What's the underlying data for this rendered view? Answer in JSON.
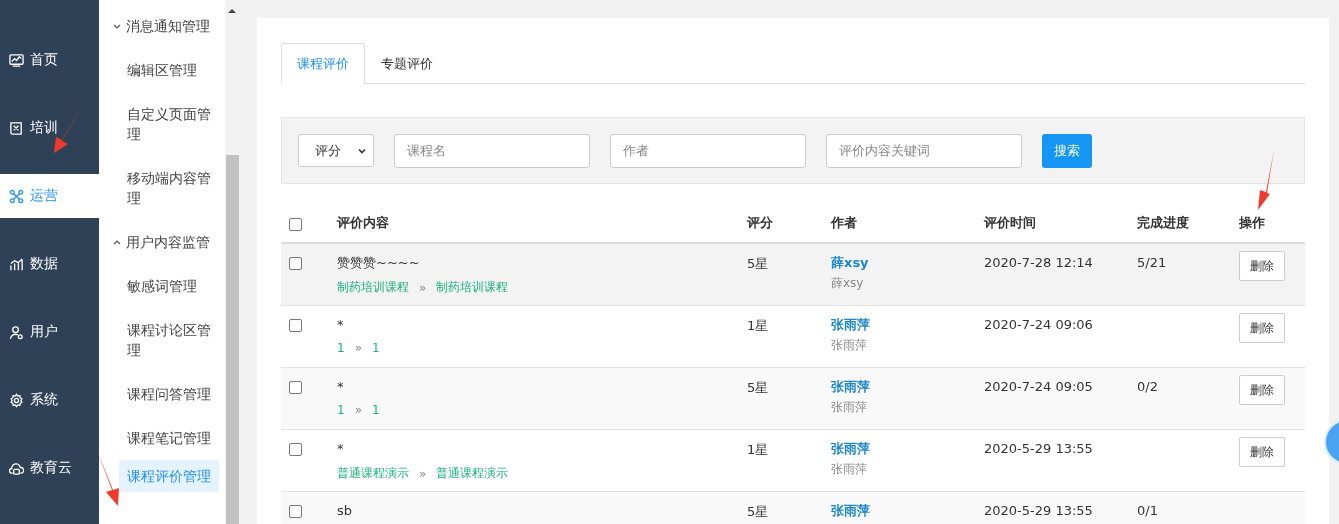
{
  "nav": [
    {
      "label": "首页",
      "selected": false
    },
    {
      "label": "培训",
      "selected": false
    },
    {
      "label": "运营",
      "selected": true
    },
    {
      "label": "数据",
      "selected": false
    },
    {
      "label": "用户",
      "selected": false
    },
    {
      "label": "系统",
      "selected": false
    },
    {
      "label": "教育云",
      "selected": false
    }
  ],
  "submenu": [
    {
      "kind": "group",
      "label": "消息通知管理",
      "expanded": false
    },
    {
      "kind": "item",
      "label": "编辑区管理",
      "selected": false
    },
    {
      "kind": "item",
      "label": "自定义页面管理",
      "selected": false
    },
    {
      "kind": "item",
      "label": "移动端内容管理",
      "selected": false
    },
    {
      "kind": "group",
      "label": "用户内容监管",
      "expanded": true,
      "children": [
        {
          "label": "敏感词管理",
          "selected": false
        },
        {
          "label": "课程讨论区管理",
          "selected": false
        },
        {
          "label": "课程问答管理",
          "selected": false
        },
        {
          "label": "课程笔记管理",
          "selected": false
        },
        {
          "label": "课程评价管理",
          "selected": true
        }
      ]
    }
  ],
  "tabs": [
    {
      "label": "课程评价",
      "selected": true
    },
    {
      "label": "专题评价",
      "selected": false
    }
  ],
  "filters": {
    "rating_select": "评分",
    "course_placeholder": "课程名",
    "author_placeholder": "作者",
    "keyword_placeholder": "评价内容关键词",
    "search_button": "搜索"
  },
  "table": {
    "select_all_checked": false,
    "columns": [
      "评价内容",
      "评分",
      "作者",
      "评价时间",
      "完成进度",
      "操作"
    ],
    "rows": [
      {
        "checked": false,
        "content": "赞赞赞~~~~",
        "course": "制药培训课程",
        "chapter": "制药培训课程",
        "rating": "5星",
        "author": "薛xsy",
        "author_sub": "薛xsy",
        "time": "2020-7-28 12:14",
        "progress": "5/21",
        "action": "删除"
      },
      {
        "checked": false,
        "content": "*",
        "course": "1",
        "chapter": "1",
        "rating": "1星",
        "author": "张雨萍",
        "author_sub": "张雨萍",
        "time": "2020-7-24 09:06",
        "action": "删除"
      },
      {
        "checked": false,
        "content": "*",
        "course": "1",
        "chapter": "1",
        "rating": "5星",
        "author": "张雨萍",
        "author_sub": "张雨萍",
        "time": "2020-7-24 09:05",
        "progress": "0/2",
        "action": "删除"
      },
      {
        "checked": false,
        "content": "*",
        "course": "普通课程演示",
        "chapter": "普通课程演示",
        "rating": "1星",
        "author": "张雨萍",
        "author_sub": "张雨萍",
        "time": "2020-5-29 13:55",
        "action": "删除"
      },
      {
        "checked": false,
        "content": "sb",
        "rating": "5星",
        "author": "张雨萍",
        "time": "2020-5-29 13:55",
        "progress": "0/1"
      }
    ]
  },
  "separator": "»"
}
